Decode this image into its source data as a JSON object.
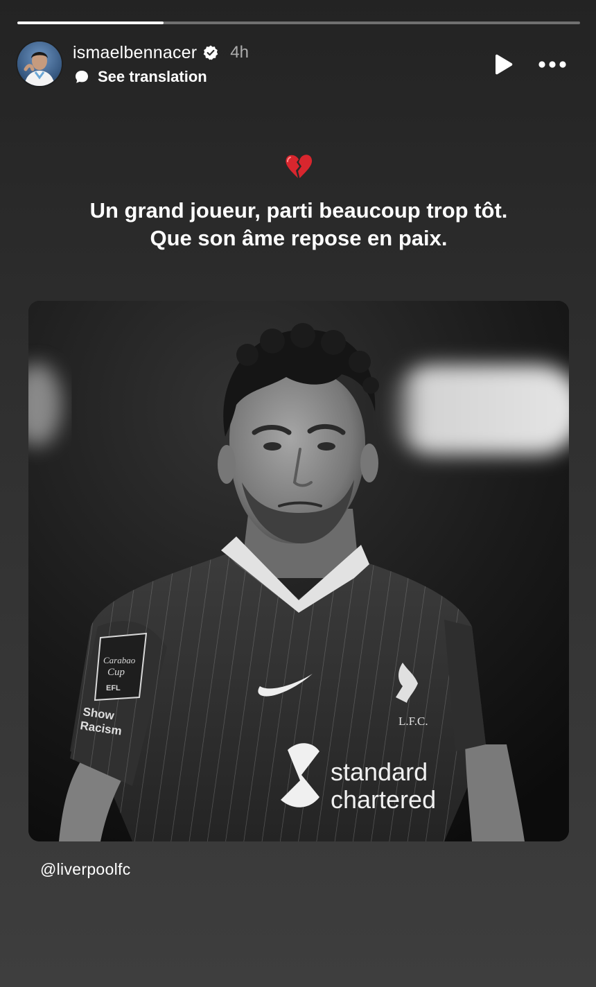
{
  "story": {
    "progress": {
      "fraction": 0.26
    },
    "header": {
      "username": "ismaelbennacer",
      "verified": true,
      "time_ago": "4h",
      "translation_label": "See translation",
      "icons": {
        "verified": "verified-badge-icon",
        "translate": "translate-icon",
        "play": "play-icon",
        "more": "more-options-icon"
      }
    },
    "content": {
      "emoji": "💔",
      "caption_line1": "Un grand joueur, parti beaucoup trop tôt.",
      "caption_line2": "Que son âme repose en paix.",
      "photo_alt": "Black-and-white photo of a footballer in a Liverpool kit",
      "photo_text": {
        "sponsor_line1": "standard",
        "sponsor_line2": "chartered",
        "badge_line1": "Carabao",
        "badge_line2": "Cup",
        "badge_efl": "EFL",
        "sleeve_line1": "Show",
        "sleeve_line2": "Racism",
        "crest": "L.F.C."
      },
      "mention": "@liverpoolfc"
    },
    "colors": {
      "background_top": "#232323",
      "background_bottom": "#3e3e3e",
      "text": "#ffffff",
      "muted_text": "#9e9e9e"
    }
  }
}
